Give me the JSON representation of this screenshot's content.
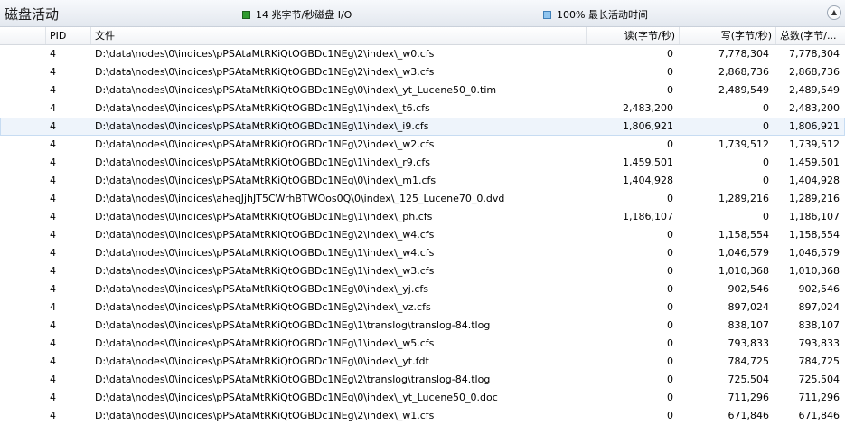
{
  "window": {
    "title": "磁盘活动"
  },
  "legend": [
    {
      "label": "14 兆字节/秒磁盘 I/O",
      "color": "#2e9a2e",
      "icon": "green-square-icon"
    },
    {
      "label": "100% 最长活动时间",
      "color": "#8fc4ee",
      "icon": "blue-square-icon"
    }
  ],
  "collapse_icon": "▲",
  "columns": [
    "",
    "PID",
    "文件",
    "读(字节/秒)",
    "写(字节/秒)",
    "总数(字节/..."
  ],
  "rows": [
    {
      "pid": "4",
      "file": "D:\\data\\nodes\\0\\indices\\pPSAtaMtRKiQtOGBDc1NEg\\2\\index\\_w0.cfs",
      "read": "0",
      "write": "7,778,304",
      "total": "7,778,304"
    },
    {
      "pid": "4",
      "file": "D:\\data\\nodes\\0\\indices\\pPSAtaMtRKiQtOGBDc1NEg\\2\\index\\_w3.cfs",
      "read": "0",
      "write": "2,868,736",
      "total": "2,868,736"
    },
    {
      "pid": "4",
      "file": "D:\\data\\nodes\\0\\indices\\pPSAtaMtRKiQtOGBDc1NEg\\0\\index\\_yt_Lucene50_0.tim",
      "read": "0",
      "write": "2,489,549",
      "total": "2,489,549"
    },
    {
      "pid": "4",
      "file": "D:\\data\\nodes\\0\\indices\\pPSAtaMtRKiQtOGBDc1NEg\\1\\index\\_t6.cfs",
      "read": "2,483,200",
      "write": "0",
      "total": "2,483,200"
    },
    {
      "pid": "4",
      "file": "D:\\data\\nodes\\0\\indices\\pPSAtaMtRKiQtOGBDc1NEg\\1\\index\\_i9.cfs",
      "read": "1,806,921",
      "write": "0",
      "total": "1,806,921",
      "highlight": true
    },
    {
      "pid": "4",
      "file": "D:\\data\\nodes\\0\\indices\\pPSAtaMtRKiQtOGBDc1NEg\\2\\index\\_w2.cfs",
      "read": "0",
      "write": "1,739,512",
      "total": "1,739,512"
    },
    {
      "pid": "4",
      "file": "D:\\data\\nodes\\0\\indices\\pPSAtaMtRKiQtOGBDc1NEg\\1\\index\\_r9.cfs",
      "read": "1,459,501",
      "write": "0",
      "total": "1,459,501"
    },
    {
      "pid": "4",
      "file": "D:\\data\\nodes\\0\\indices\\pPSAtaMtRKiQtOGBDc1NEg\\0\\index\\_m1.cfs",
      "read": "1,404,928",
      "write": "0",
      "total": "1,404,928"
    },
    {
      "pid": "4",
      "file": "D:\\data\\nodes\\0\\indices\\aheqJjhJT5CWrhBTWOos0Q\\0\\index\\_125_Lucene70_0.dvd",
      "read": "0",
      "write": "1,289,216",
      "total": "1,289,216"
    },
    {
      "pid": "4",
      "file": "D:\\data\\nodes\\0\\indices\\pPSAtaMtRKiQtOGBDc1NEg\\1\\index\\_ph.cfs",
      "read": "1,186,107",
      "write": "0",
      "total": "1,186,107"
    },
    {
      "pid": "4",
      "file": "D:\\data\\nodes\\0\\indices\\pPSAtaMtRKiQtOGBDc1NEg\\2\\index\\_w4.cfs",
      "read": "0",
      "write": "1,158,554",
      "total": "1,158,554"
    },
    {
      "pid": "4",
      "file": "D:\\data\\nodes\\0\\indices\\pPSAtaMtRKiQtOGBDc1NEg\\1\\index\\_w4.cfs",
      "read": "0",
      "write": "1,046,579",
      "total": "1,046,579"
    },
    {
      "pid": "4",
      "file": "D:\\data\\nodes\\0\\indices\\pPSAtaMtRKiQtOGBDc1NEg\\1\\index\\_w3.cfs",
      "read": "0",
      "write": "1,010,368",
      "total": "1,010,368"
    },
    {
      "pid": "4",
      "file": "D:\\data\\nodes\\0\\indices\\pPSAtaMtRKiQtOGBDc1NEg\\0\\index\\_yj.cfs",
      "read": "0",
      "write": "902,546",
      "total": "902,546"
    },
    {
      "pid": "4",
      "file": "D:\\data\\nodes\\0\\indices\\pPSAtaMtRKiQtOGBDc1NEg\\2\\index\\_vz.cfs",
      "read": "0",
      "write": "897,024",
      "total": "897,024"
    },
    {
      "pid": "4",
      "file": "D:\\data\\nodes\\0\\indices\\pPSAtaMtRKiQtOGBDc1NEg\\1\\translog\\translog-84.tlog",
      "read": "0",
      "write": "838,107",
      "total": "838,107"
    },
    {
      "pid": "4",
      "file": "D:\\data\\nodes\\0\\indices\\pPSAtaMtRKiQtOGBDc1NEg\\1\\index\\_w5.cfs",
      "read": "0",
      "write": "793,833",
      "total": "793,833"
    },
    {
      "pid": "4",
      "file": "D:\\data\\nodes\\0\\indices\\pPSAtaMtRKiQtOGBDc1NEg\\0\\index\\_yt.fdt",
      "read": "0",
      "write": "784,725",
      "total": "784,725"
    },
    {
      "pid": "4",
      "file": "D:\\data\\nodes\\0\\indices\\pPSAtaMtRKiQtOGBDc1NEg\\2\\translog\\translog-84.tlog",
      "read": "0",
      "write": "725,504",
      "total": "725,504"
    },
    {
      "pid": "4",
      "file": "D:\\data\\nodes\\0\\indices\\pPSAtaMtRKiQtOGBDc1NEg\\0\\index\\_yt_Lucene50_0.doc",
      "read": "0",
      "write": "711,296",
      "total": "711,296"
    },
    {
      "pid": "4",
      "file": "D:\\data\\nodes\\0\\indices\\pPSAtaMtRKiQtOGBDc1NEg\\2\\index\\_w1.cfs",
      "read": "0",
      "write": "671,846",
      "total": "671,846"
    }
  ]
}
